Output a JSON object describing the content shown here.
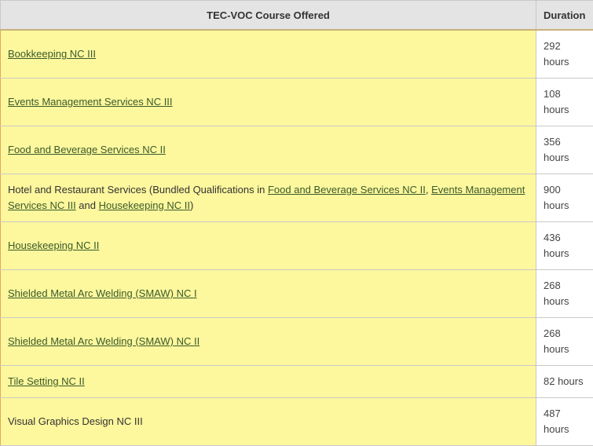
{
  "header": {
    "course_col": "TEC-VOC Course Offered",
    "duration_col": "Duration"
  },
  "rows": [
    {
      "course": "Bookkeeping NC III",
      "duration": "292 hours"
    },
    {
      "course": "Events Management Services NC III",
      "duration": "108 hours"
    },
    {
      "course": "Food and Beverage Services NC II",
      "duration": "356 hours"
    },
    {
      "course_prefix": "Hotel and Restaurant Services (Bundled Qualifications in ",
      "link1": "Food and Beverage Services NC II",
      "sep1": ", ",
      "link2": "Events Management Services NC III",
      "sep2": " and ",
      "link3": "Housekeeping NC II",
      "suffix": ")",
      "duration": "900 hours"
    },
    {
      "course": "Housekeeping NC II",
      "duration": "436 hours"
    },
    {
      "course": "Shielded Metal Arc Welding (SMAW) NC I",
      "duration": "268 hours"
    },
    {
      "course": "Shielded Metal Arc Welding (SMAW) NC II",
      "duration": "268 hours"
    },
    {
      "course": "Tile Setting NC II",
      "duration": "82 hours"
    },
    {
      "course": "Visual Graphics Design NC III",
      "duration": "487 hours"
    }
  ]
}
